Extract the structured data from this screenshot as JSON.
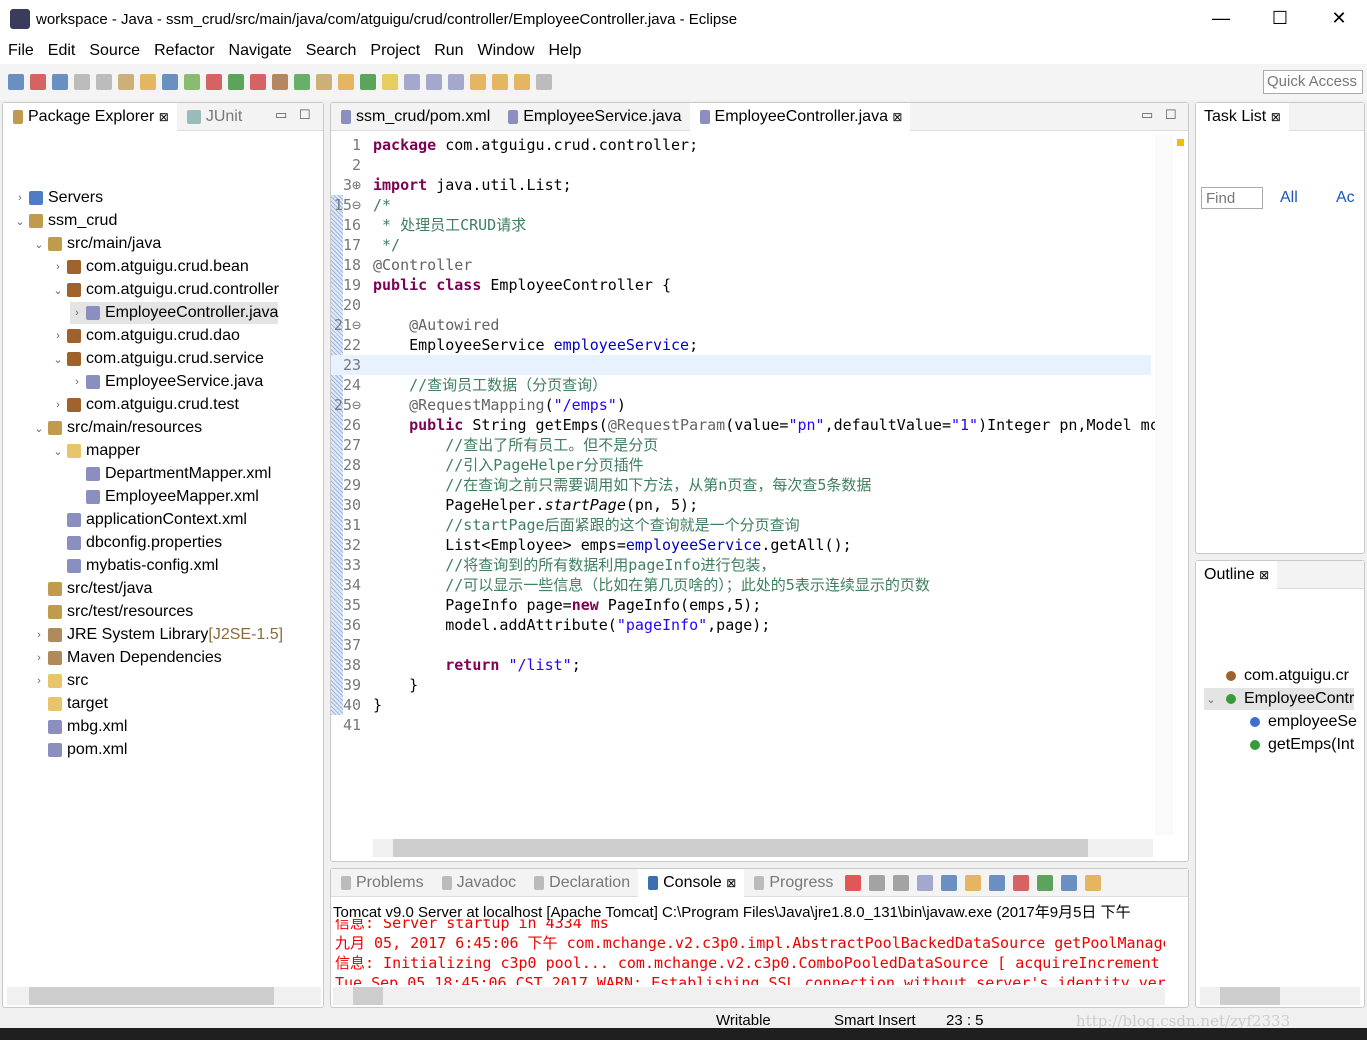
{
  "window": {
    "title": "workspace - Java - ssm_crud/src/main/java/com/atguigu/crud/controller/EmployeeController.java - Eclipse",
    "minimize": "—",
    "maximize": "☐",
    "close": "✕"
  },
  "menu": [
    "File",
    "Edit",
    "Source",
    "Refactor",
    "Navigate",
    "Search",
    "Project",
    "Run",
    "Window",
    "Help"
  ],
  "toolbar": {
    "quick_access": "Quick Access"
  },
  "package_explorer": {
    "tabs": [
      {
        "label": "Package Explorer",
        "close": "⊠"
      },
      {
        "label": "JUnit"
      }
    ],
    "items": [
      {
        "level": 0,
        "tw": "›",
        "icon": "server-folder",
        "color": "#4f7dc1",
        "label": "Servers"
      },
      {
        "level": 0,
        "tw": "⌄",
        "icon": "project",
        "color": "#c09a4d",
        "label": "ssm_crud"
      },
      {
        "level": 1,
        "tw": "⌄",
        "icon": "source-folder",
        "color": "#c09a4d",
        "label": "src/main/java"
      },
      {
        "level": 2,
        "tw": "›",
        "icon": "package",
        "color": "#a0622d",
        "label": "com.atguigu.crud.bean"
      },
      {
        "level": 2,
        "tw": "⌄",
        "icon": "package",
        "color": "#a0622d",
        "label": "com.atguigu.crud.controller"
      },
      {
        "level": 3,
        "tw": "›",
        "icon": "java-file",
        "color": "#8a8fbf",
        "label": "EmployeeController.java",
        "selected": true
      },
      {
        "level": 2,
        "tw": "›",
        "icon": "package",
        "color": "#a0622d",
        "label": "com.atguigu.crud.dao"
      },
      {
        "level": 2,
        "tw": "⌄",
        "icon": "package",
        "color": "#a0622d",
        "label": "com.atguigu.crud.service"
      },
      {
        "level": 3,
        "tw": "›",
        "icon": "java-file",
        "color": "#8a8fbf",
        "label": "EmployeeService.java"
      },
      {
        "level": 2,
        "tw": "›",
        "icon": "package",
        "color": "#a0622d",
        "label": "com.atguigu.crud.test"
      },
      {
        "level": 1,
        "tw": "⌄",
        "icon": "source-folder",
        "color": "#c09a4d",
        "label": "src/main/resources"
      },
      {
        "level": 2,
        "tw": "⌄",
        "icon": "folder",
        "color": "#e8c56a",
        "label": "mapper"
      },
      {
        "level": 3,
        "tw": "",
        "icon": "xml-file",
        "color": "#8a8fbf",
        "label": "DepartmentMapper.xml"
      },
      {
        "level": 3,
        "tw": "",
        "icon": "xml-file",
        "color": "#8a8fbf",
        "label": "EmployeeMapper.xml"
      },
      {
        "level": 2,
        "tw": "",
        "icon": "xml-file",
        "color": "#8a8fbf",
        "label": "applicationContext.xml"
      },
      {
        "level": 2,
        "tw": "",
        "icon": "properties-file",
        "color": "#8a8fbf",
        "label": "dbconfig.properties"
      },
      {
        "level": 2,
        "tw": "",
        "icon": "xml-file",
        "color": "#8a8fbf",
        "label": "mybatis-config.xml"
      },
      {
        "level": 1,
        "tw": "",
        "icon": "source-folder",
        "color": "#c09a4d",
        "label": "src/test/java"
      },
      {
        "level": 1,
        "tw": "",
        "icon": "source-folder",
        "color": "#c09a4d",
        "label": "src/test/resources"
      },
      {
        "level": 1,
        "tw": "›",
        "icon": "library",
        "color": "#b08a5a",
        "label": "JRE System Library",
        "suffix": " [J2SE-1.5]"
      },
      {
        "level": 1,
        "tw": "›",
        "icon": "library",
        "color": "#b08a5a",
        "label": "Maven Dependencies"
      },
      {
        "level": 1,
        "tw": "›",
        "icon": "folder",
        "color": "#e8c56a",
        "label": "src"
      },
      {
        "level": 1,
        "tw": "",
        "icon": "folder",
        "color": "#e8c56a",
        "label": "target"
      },
      {
        "level": 1,
        "tw": "",
        "icon": "xml-file",
        "color": "#8a8fbf",
        "label": "mbg.xml"
      },
      {
        "level": 1,
        "tw": "",
        "icon": "maven-pom",
        "color": "#8a8fbf",
        "label": "pom.xml"
      }
    ]
  },
  "editor": {
    "tabs": [
      {
        "label": "ssm_crud/pom.xml"
      },
      {
        "label": "EmployeeService.java"
      },
      {
        "label": "EmployeeController.java",
        "active": true,
        "close": "⊠"
      }
    ],
    "current_line": "23",
    "lines": [
      {
        "n": "1",
        "t": [
          [
            "k",
            "package"
          ],
          [
            "n",
            " com.atguigu.crud.controller;"
          ]
        ]
      },
      {
        "n": "2",
        "t": []
      },
      {
        "n": "3⊕",
        "t": [
          [
            "k",
            "import"
          ],
          [
            "n",
            " java.util.List;"
          ]
        ]
      },
      {
        "n": "15⊖",
        "t": [
          [
            "c",
            "/*"
          ]
        ]
      },
      {
        "n": "16",
        "t": [
          [
            "c",
            " * 处理员工CRUD请求"
          ]
        ]
      },
      {
        "n": "17",
        "t": [
          [
            "c",
            " */"
          ]
        ]
      },
      {
        "n": "18",
        "t": [
          [
            "a",
            "@Controller"
          ]
        ]
      },
      {
        "n": "19",
        "t": [
          [
            "k",
            "public"
          ],
          [
            "n",
            " "
          ],
          [
            "k",
            "class"
          ],
          [
            "n",
            " EmployeeController {"
          ]
        ]
      },
      {
        "n": "20",
        "t": []
      },
      {
        "n": "21⊖",
        "t": [
          [
            "a",
            "    @Autowired"
          ]
        ]
      },
      {
        "n": "22",
        "t": [
          [
            "n",
            "    EmployeeService "
          ],
          [
            "f",
            "employeeService"
          ],
          [
            "n",
            ";"
          ]
        ]
      },
      {
        "n": "23",
        "t": []
      },
      {
        "n": "24",
        "t": [
          [
            "c",
            "    //查询员工数据（分页查询）"
          ]
        ]
      },
      {
        "n": "25⊖",
        "t": [
          [
            "a",
            "    @RequestMapping"
          ],
          [
            "n",
            "("
          ],
          [
            "s",
            "\"/emps\""
          ],
          [
            "n",
            ")"
          ]
        ]
      },
      {
        "n": "26",
        "t": [
          [
            "n",
            "    "
          ],
          [
            "k",
            "public"
          ],
          [
            "n",
            " String getEmps("
          ],
          [
            "a",
            "@RequestParam"
          ],
          [
            "n",
            "(value="
          ],
          [
            "s",
            "\"pn\""
          ],
          [
            "n",
            ",defaultValue="
          ],
          [
            "s",
            "\"1\""
          ],
          [
            "n",
            ")Integer pn,Model mc"
          ]
        ]
      },
      {
        "n": "27",
        "t": [
          [
            "c",
            "        //查出了所有员工。但不是分页"
          ]
        ]
      },
      {
        "n": "28",
        "t": [
          [
            "c",
            "        //引入PageHelper分页插件"
          ]
        ]
      },
      {
        "n": "29",
        "t": [
          [
            "c",
            "        //在查询之前只需要调用如下方法，从第n页查，每次查5条数据"
          ]
        ]
      },
      {
        "n": "30",
        "t": [
          [
            "n",
            "        PageHelper."
          ],
          [
            "i",
            "startPage"
          ],
          [
            "n",
            "(pn, 5);"
          ]
        ]
      },
      {
        "n": "31",
        "t": [
          [
            "c",
            "        //startPage后面紧跟的这个查询就是一个分页查询"
          ]
        ]
      },
      {
        "n": "32",
        "t": [
          [
            "n",
            "        List<Employee> emps="
          ],
          [
            "f",
            "employeeService"
          ],
          [
            "n",
            ".getAll();"
          ]
        ]
      },
      {
        "n": "33",
        "t": [
          [
            "c",
            "        //将查询到的所有数据利用pageInfo进行包装，"
          ]
        ]
      },
      {
        "n": "34",
        "t": [
          [
            "c",
            "        //可以显示一些信息（比如在第几页啥的）；此处的5表示连续显示的页数"
          ]
        ]
      },
      {
        "n": "35",
        "t": [
          [
            "n",
            "        PageInfo page="
          ],
          [
            "k",
            "new"
          ],
          [
            "n",
            " PageInfo(emps,5);"
          ]
        ]
      },
      {
        "n": "36",
        "t": [
          [
            "n",
            "        model.addAttribute("
          ],
          [
            "s",
            "\"pageInfo\""
          ],
          [
            "n",
            ",page);"
          ]
        ]
      },
      {
        "n": "37",
        "t": []
      },
      {
        "n": "38",
        "t": [
          [
            "n",
            "        "
          ],
          [
            "k",
            "return"
          ],
          [
            "n",
            " "
          ],
          [
            "s",
            "\"/list\""
          ],
          [
            "n",
            ";"
          ]
        ]
      },
      {
        "n": "39",
        "t": [
          [
            "n",
            "    }"
          ]
        ]
      },
      {
        "n": "40",
        "t": [
          [
            "n",
            "}"
          ]
        ]
      },
      {
        "n": "41",
        "t": []
      }
    ]
  },
  "task_list": {
    "title": "Task List",
    "close": "⊠",
    "find_placeholder": "Find",
    "all": "All",
    "activate": "Ac"
  },
  "outline": {
    "title": "Outline",
    "close": "⊠",
    "items": [
      {
        "level": 0,
        "tw": "",
        "color": "#a0622d",
        "label": "com.atguigu.cr"
      },
      {
        "level": 0,
        "tw": "⌄",
        "color": "#3a9a3a",
        "label": "EmployeeContr",
        "selected": true
      },
      {
        "level": 1,
        "tw": "",
        "color": "#3d6fd1",
        "label": "employeeSe"
      },
      {
        "level": 1,
        "tw": "",
        "color": "#3a9a3a",
        "label": "getEmps(Int"
      }
    ]
  },
  "console": {
    "tabs": [
      {
        "label": "Problems"
      },
      {
        "label": "Javadoc"
      },
      {
        "label": "Declaration"
      },
      {
        "label": "Console",
        "active": true,
        "close": "⊠"
      },
      {
        "label": "Progress"
      }
    ],
    "header": "Tomcat v9.0 Server at localhost [Apache Tomcat] C:\\Program Files\\Java\\jre1.8.0_131\\bin\\javaw.exe (2017年9月5日 下午",
    "lines": [
      "信息: Server startup in 4334 ms",
      "九月 05, 2017 6:45:06 下午 com.mchange.v2.c3p0.impl.AbstractPoolBackedDataSource getPoolManage",
      "信息: Initializing c3p0 pool... com.mchange.v2.c3p0.ComboPooledDataSource [ acquireIncrement",
      "Tue Sep 05 18:45:06 CST 2017 WARN: Establishing SSL connection without server's identity veri"
    ]
  },
  "status": {
    "writable": "Writable",
    "insert_mode": "Smart Insert",
    "position": "23 : 5",
    "watermark": "http://blog.csdn.net/zyf2333"
  }
}
